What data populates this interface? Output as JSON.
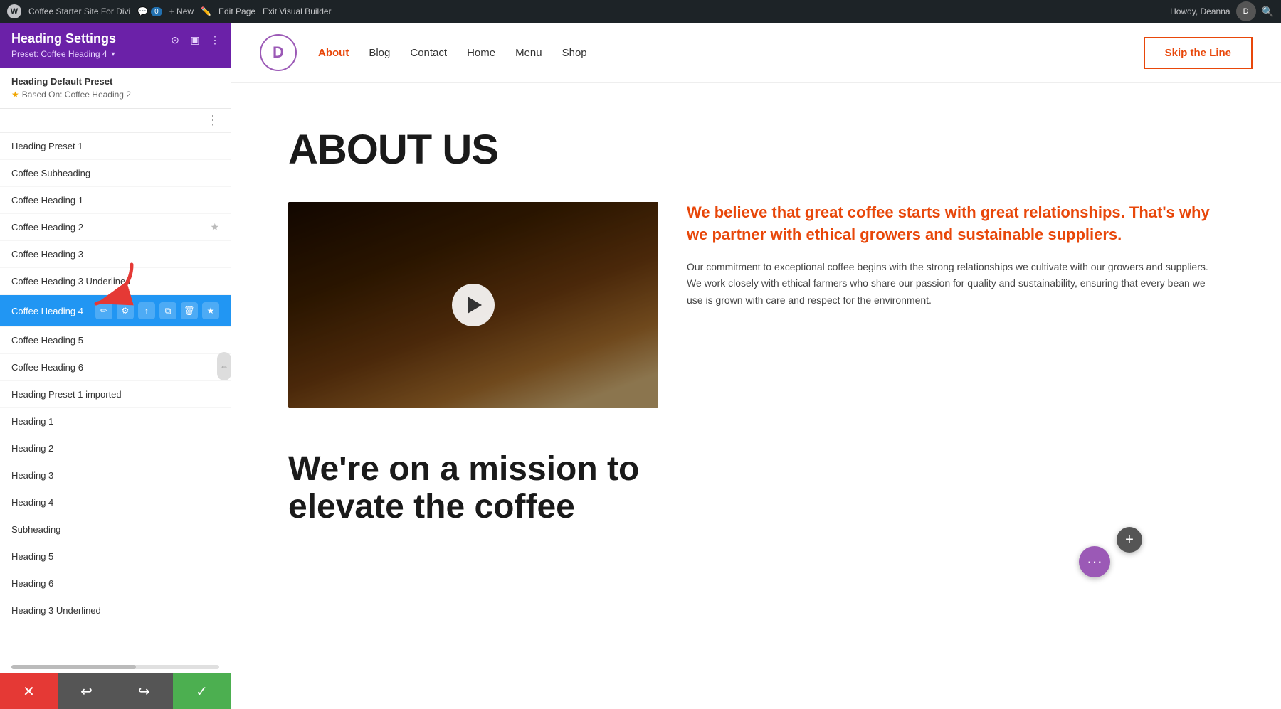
{
  "admin_bar": {
    "wp_label": "W",
    "site_name": "Coffee Starter Site For Divi",
    "comments": "0",
    "new_label": "+ New",
    "edit_page_label": "Edit Page",
    "exit_builder_label": "Exit Visual Builder",
    "howdy": "Howdy, Deanna"
  },
  "panel": {
    "title": "Heading Settings",
    "subtitle": "Preset: Coffee Heading 4",
    "default_preset": {
      "title": "Heading Default Preset",
      "based_on_label": "Based On: Coffee Heading 2"
    },
    "presets": [
      {
        "id": 1,
        "name": "Heading Preset 1",
        "starred": false,
        "active": false
      },
      {
        "id": 2,
        "name": "Coffee Subheading",
        "starred": false,
        "active": false
      },
      {
        "id": 3,
        "name": "Coffee Heading 1",
        "starred": false,
        "active": false
      },
      {
        "id": 4,
        "name": "Coffee Heading 2",
        "starred": true,
        "active": false
      },
      {
        "id": 5,
        "name": "Coffee Heading 3",
        "starred": false,
        "active": false
      },
      {
        "id": 6,
        "name": "Coffee Heading 3 Underlined",
        "starred": false,
        "active": false
      },
      {
        "id": 7,
        "name": "Coffee Heading 4",
        "starred": true,
        "active": true
      },
      {
        "id": 8,
        "name": "Coffee Heading 5",
        "starred": false,
        "active": false
      },
      {
        "id": 9,
        "name": "Coffee Heading 6",
        "starred": false,
        "active": false
      },
      {
        "id": 10,
        "name": "Heading Preset 1 imported",
        "starred": false,
        "active": false
      },
      {
        "id": 11,
        "name": "Heading 1",
        "starred": false,
        "active": false
      },
      {
        "id": 12,
        "name": "Heading 2",
        "starred": false,
        "active": false
      },
      {
        "id": 13,
        "name": "Heading 3",
        "starred": false,
        "active": false
      },
      {
        "id": 14,
        "name": "Heading 4",
        "starred": false,
        "active": false
      },
      {
        "id": 15,
        "name": "Subheading",
        "starred": false,
        "active": false
      },
      {
        "id": 16,
        "name": "Heading 5",
        "starred": false,
        "active": false
      },
      {
        "id": 17,
        "name": "Heading 6",
        "starred": false,
        "active": false
      },
      {
        "id": 18,
        "name": "Heading 3 Underlined",
        "starred": false,
        "active": false
      }
    ],
    "footer": {
      "cancel": "✕",
      "undo": "↩",
      "redo": "↪",
      "save": "✓"
    }
  },
  "site": {
    "logo_letter": "D",
    "nav_links": [
      "About",
      "Blog",
      "Contact",
      "Home",
      "Menu",
      "Shop"
    ],
    "active_nav": "About",
    "cta_button": "Skip the Line",
    "hero_heading": "ABOUT US",
    "highlight_text": "We believe that great coffee starts with great relationships. That's why we partner with ethical growers and sustainable suppliers.",
    "body_text": "Our commitment to exceptional coffee begins with the strong relationships we cultivate with our growers and suppliers. We work closely with ethical farmers who share our passion for quality and sustainability, ensuring that every bean we use is grown with care and respect for the environment.",
    "bottom_heading_line1": "We're on a mission to",
    "bottom_heading_line2": "elevate the coffee"
  },
  "colors": {
    "purple_header": "#6b21a8",
    "active_blue": "#2196f3",
    "orange_accent": "#e8470a",
    "green_save": "#4caf50",
    "red_cancel": "#e53935"
  }
}
